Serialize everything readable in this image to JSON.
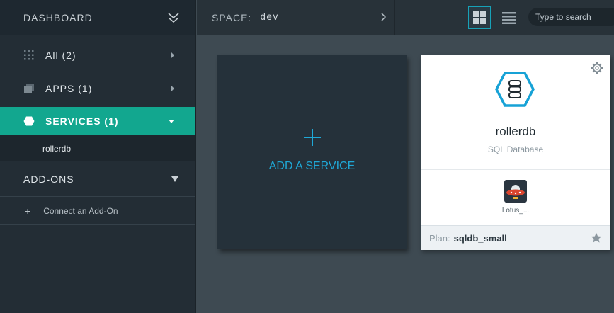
{
  "sidebar": {
    "header": "DASHBOARD",
    "items": [
      {
        "label": "All (2)",
        "icon": "grid-dots-icon"
      },
      {
        "label": "APPS (1)",
        "icon": "stack-icon"
      },
      {
        "label": "SERVICES (1)",
        "icon": "hexagon-icon",
        "active": true
      }
    ],
    "sub_item": "rollerdb",
    "addons_label": "ADD-ONS",
    "connect_label": "Connect an Add-On"
  },
  "topbar": {
    "space_label": "SPACE:",
    "space_value": "dev",
    "search_placeholder": "Type to search"
  },
  "add_card": {
    "label": "ADD A SERVICE"
  },
  "service_card": {
    "name": "rollerdb",
    "type": "SQL Database",
    "app_label": "Lotus_...",
    "plan_label": "Plan:",
    "plan_value": "sqldb_small"
  },
  "colors": {
    "accent": "#12a78f",
    "link": "#1fa8d6",
    "sidebar_bg": "#232d35",
    "content_bg": "#3e4a52"
  }
}
